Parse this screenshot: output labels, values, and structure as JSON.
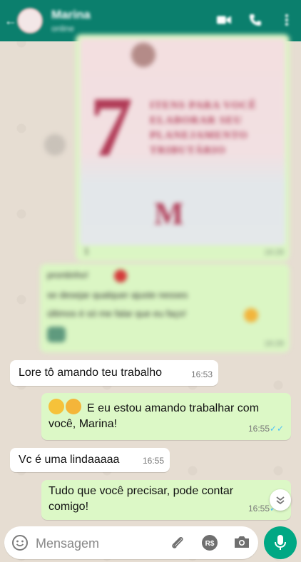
{
  "header": {
    "contact_name": "Marina",
    "contact_status": "online"
  },
  "blurred_image_message": {
    "big_number": "7",
    "title_lines": [
      "ITENS PARA VOCÊ",
      "ELABORAR SEU",
      "PLANEJAMENTO",
      "TRIBUTÁRIO"
    ],
    "mark": "M",
    "caption": "1",
    "time": "16:28"
  },
  "blurred_text_message": {
    "lines": [
      "prontinho!",
      "se desejar qualquer ajuste nesses",
      "últimos é só me falar que eu faço!"
    ],
    "time": "16:28"
  },
  "messages": [
    {
      "direction": "in",
      "text": "Lore tô amando teu trabalho",
      "time": "16:53"
    },
    {
      "direction": "out",
      "text": "E eu estou amando trabalhar com você, Marina!",
      "time": "16:55",
      "status": "read"
    },
    {
      "direction": "in",
      "text": "Vc é uma lindaaaaa",
      "time": "16:55"
    },
    {
      "direction": "out",
      "text": "Tudo que você precisar, pode contar comigo!",
      "time": "16:55",
      "status": "read"
    }
  ],
  "composer": {
    "placeholder": "Mensagem",
    "payment_label": "R$"
  },
  "colors": {
    "header": "#0b7f6d",
    "outgoing_bubble": "#dcf8c6",
    "incoming_bubble": "#ffffff",
    "read_tick": "#4fc3f7",
    "mic_button": "#00a884"
  },
  "icons": [
    "back-arrow-icon",
    "video-call-icon",
    "phone-icon",
    "more-icon",
    "share-icon",
    "scroll-down-icon",
    "emoji-icon",
    "attach-icon",
    "payment-icon",
    "camera-icon",
    "mic-icon"
  ]
}
